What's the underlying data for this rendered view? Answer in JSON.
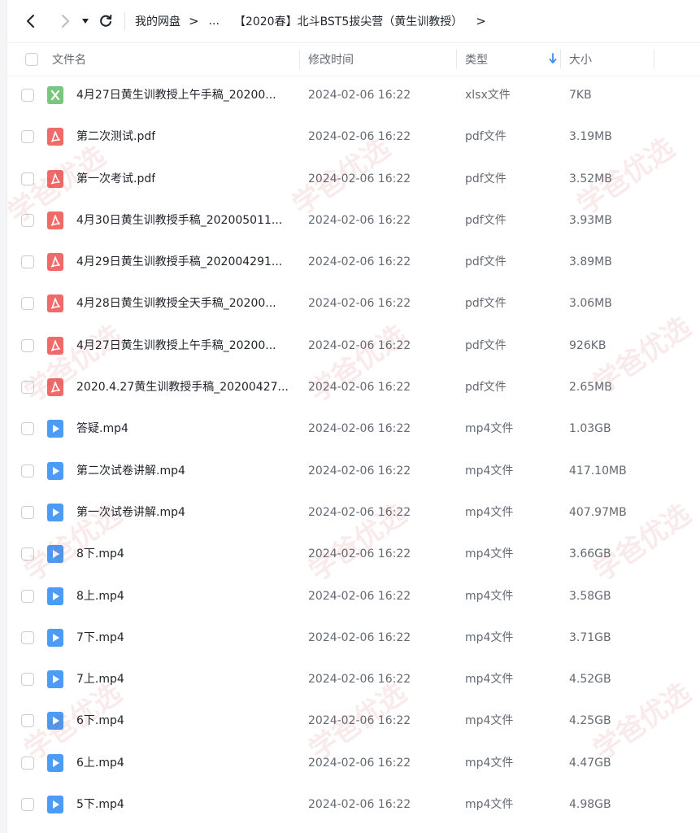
{
  "toolbar": {
    "breadcrumb_root": "我的网盘",
    "breadcrumb_ellipsis": "...",
    "breadcrumb_current": "【2020春】北斗BST5拔尖营（黄生训教授）",
    "arrow": ">"
  },
  "table": {
    "headers": {
      "name": "文件名",
      "modified": "修改时间",
      "type": "类型",
      "size": "大小"
    },
    "rows": [
      {
        "icon": "xlsx-icon",
        "name": "4月27日黄生训教授上午手稿_20200...",
        "modified": "2024-02-06 16:22",
        "type": "xlsx文件",
        "size": "7KB"
      },
      {
        "icon": "pdf-icon",
        "name": "第二次测试.pdf",
        "modified": "2024-02-06 16:22",
        "type": "pdf文件",
        "size": "3.19MB"
      },
      {
        "icon": "pdf-icon",
        "name": "第一次考试.pdf",
        "modified": "2024-02-06 16:22",
        "type": "pdf文件",
        "size": "3.52MB"
      },
      {
        "icon": "pdf-icon",
        "name": "4月30日黄生训教授手稿_202005011...",
        "modified": "2024-02-06 16:22",
        "type": "pdf文件",
        "size": "3.93MB"
      },
      {
        "icon": "pdf-icon",
        "name": "4月29日黄生训教授手稿_202004291...",
        "modified": "2024-02-06 16:22",
        "type": "pdf文件",
        "size": "3.89MB"
      },
      {
        "icon": "pdf-icon",
        "name": "4月28日黄生训教授全天手稿_20200...",
        "modified": "2024-02-06 16:22",
        "type": "pdf文件",
        "size": "3.06MB"
      },
      {
        "icon": "pdf-icon",
        "name": "4月27日黄生训教授上午手稿_20200...",
        "modified": "2024-02-06 16:22",
        "type": "pdf文件",
        "size": "926KB"
      },
      {
        "icon": "pdf-icon",
        "name": "2020.4.27黄生训教授手稿_20200427...",
        "modified": "2024-02-06 16:22",
        "type": "pdf文件",
        "size": "2.65MB"
      },
      {
        "icon": "video-icon",
        "name": "答疑.mp4",
        "modified": "2024-02-06 16:22",
        "type": "mp4文件",
        "size": "1.03GB"
      },
      {
        "icon": "video-icon",
        "name": "第二次试卷讲解.mp4",
        "modified": "2024-02-06 16:22",
        "type": "mp4文件",
        "size": "417.10MB"
      },
      {
        "icon": "video-icon",
        "name": "第一次试卷讲解.mp4",
        "modified": "2024-02-06 16:22",
        "type": "mp4文件",
        "size": "407.97MB"
      },
      {
        "icon": "video-icon",
        "name": "8下.mp4",
        "modified": "2024-02-06 16:22",
        "type": "mp4文件",
        "size": "3.66GB"
      },
      {
        "icon": "video-icon",
        "name": "8上.mp4",
        "modified": "2024-02-06 16:22",
        "type": "mp4文件",
        "size": "3.58GB"
      },
      {
        "icon": "video-icon",
        "name": "7下.mp4",
        "modified": "2024-02-06 16:22",
        "type": "mp4文件",
        "size": "3.71GB"
      },
      {
        "icon": "video-icon",
        "name": "7上.mp4",
        "modified": "2024-02-06 16:22",
        "type": "mp4文件",
        "size": "4.52GB"
      },
      {
        "icon": "video-icon",
        "name": "6下.mp4",
        "modified": "2024-02-06 16:22",
        "type": "mp4文件",
        "size": "4.25GB"
      },
      {
        "icon": "video-icon",
        "name": "6上.mp4",
        "modified": "2024-02-06 16:22",
        "type": "mp4文件",
        "size": "4.47GB"
      },
      {
        "icon": "video-icon",
        "name": "5下.mp4",
        "modified": "2024-02-06 16:22",
        "type": "mp4文件",
        "size": "4.98GB"
      }
    ]
  },
  "watermark": {
    "text": "学爸优选"
  },
  "colors": {
    "xlsx": "#7bc67e",
    "pdf": "#f06a6a",
    "video": "#4c9bf5",
    "sort_accent": "#3a8ef6"
  }
}
